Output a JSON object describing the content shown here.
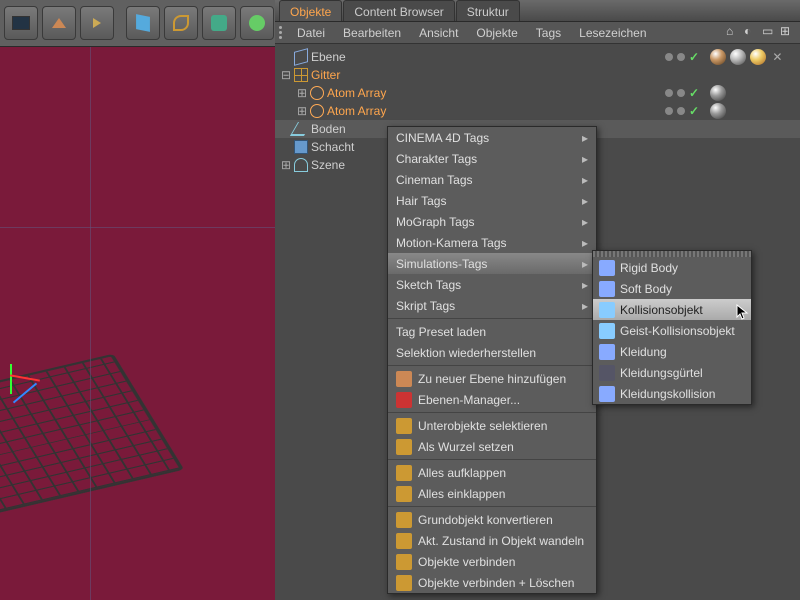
{
  "tabs": [
    "Objekte",
    "Content Browser",
    "Struktur"
  ],
  "activeTab": 0,
  "menubar": [
    "Datei",
    "Bearbeiten",
    "Ansicht",
    "Objekte",
    "Tags",
    "Lesezeichen"
  ],
  "tree": [
    {
      "name": "Ebene",
      "indent": 0,
      "exp": "",
      "cls": "",
      "ic": "ic-plane"
    },
    {
      "name": "Gitter",
      "indent": 0,
      "exp": "⊟",
      "cls": "or",
      "ic": "ic-grid"
    },
    {
      "name": "Atom Array",
      "indent": 1,
      "exp": "⊞",
      "cls": "or",
      "ic": "ic-atom"
    },
    {
      "name": "Atom Array",
      "indent": 1,
      "exp": "⊞",
      "cls": "or",
      "ic": "ic-atom"
    },
    {
      "name": "Boden",
      "indent": 0,
      "exp": "",
      "cls": "",
      "ic": "ic-floor",
      "sel": true
    },
    {
      "name": "Schacht",
      "indent": 0,
      "exp": "",
      "cls": "",
      "ic": "ic-cube"
    },
    {
      "name": "Szene",
      "indent": 0,
      "exp": "⊞",
      "cls": "",
      "ic": "ic-stage"
    }
  ],
  "ctx": {
    "g1": [
      "CINEMA 4D Tags",
      "Charakter Tags",
      "Cineman Tags",
      "Hair Tags",
      "MoGraph Tags",
      "Motion-Kamera Tags",
      "Simulations-Tags",
      "Sketch Tags",
      "Skript Tags"
    ],
    "hl": 6,
    "g2": [
      "Tag Preset laden",
      "Selektion wiederherstellen"
    ],
    "g3": [
      {
        "l": "Zu neuer Ebene hinzufügen",
        "c": "#c85"
      },
      {
        "l": "Ebenen-Manager...",
        "c": "#c33"
      }
    ],
    "g4": [
      "Unterobjekte selektieren",
      "Als Wurzel setzen"
    ],
    "g5": [
      "Alles aufklappen",
      "Alles einklappen"
    ],
    "g6": [
      "Grundobjekt konvertieren",
      "Akt. Zustand in Objekt wandeln",
      "Objekte verbinden",
      "Objekte verbinden + Löschen"
    ]
  },
  "sub": {
    "items": [
      "Rigid Body",
      "Soft Body",
      "Kollisionsobjekt",
      "Geist-Kollisionsobjekt",
      "Kleidung",
      "Kleidungsgürtel",
      "Kleidungskollision"
    ],
    "hl": 2,
    "colors": [
      "#8af",
      "#8af",
      "#8cf",
      "#8cf",
      "#8af",
      "#556",
      "#8af"
    ]
  }
}
